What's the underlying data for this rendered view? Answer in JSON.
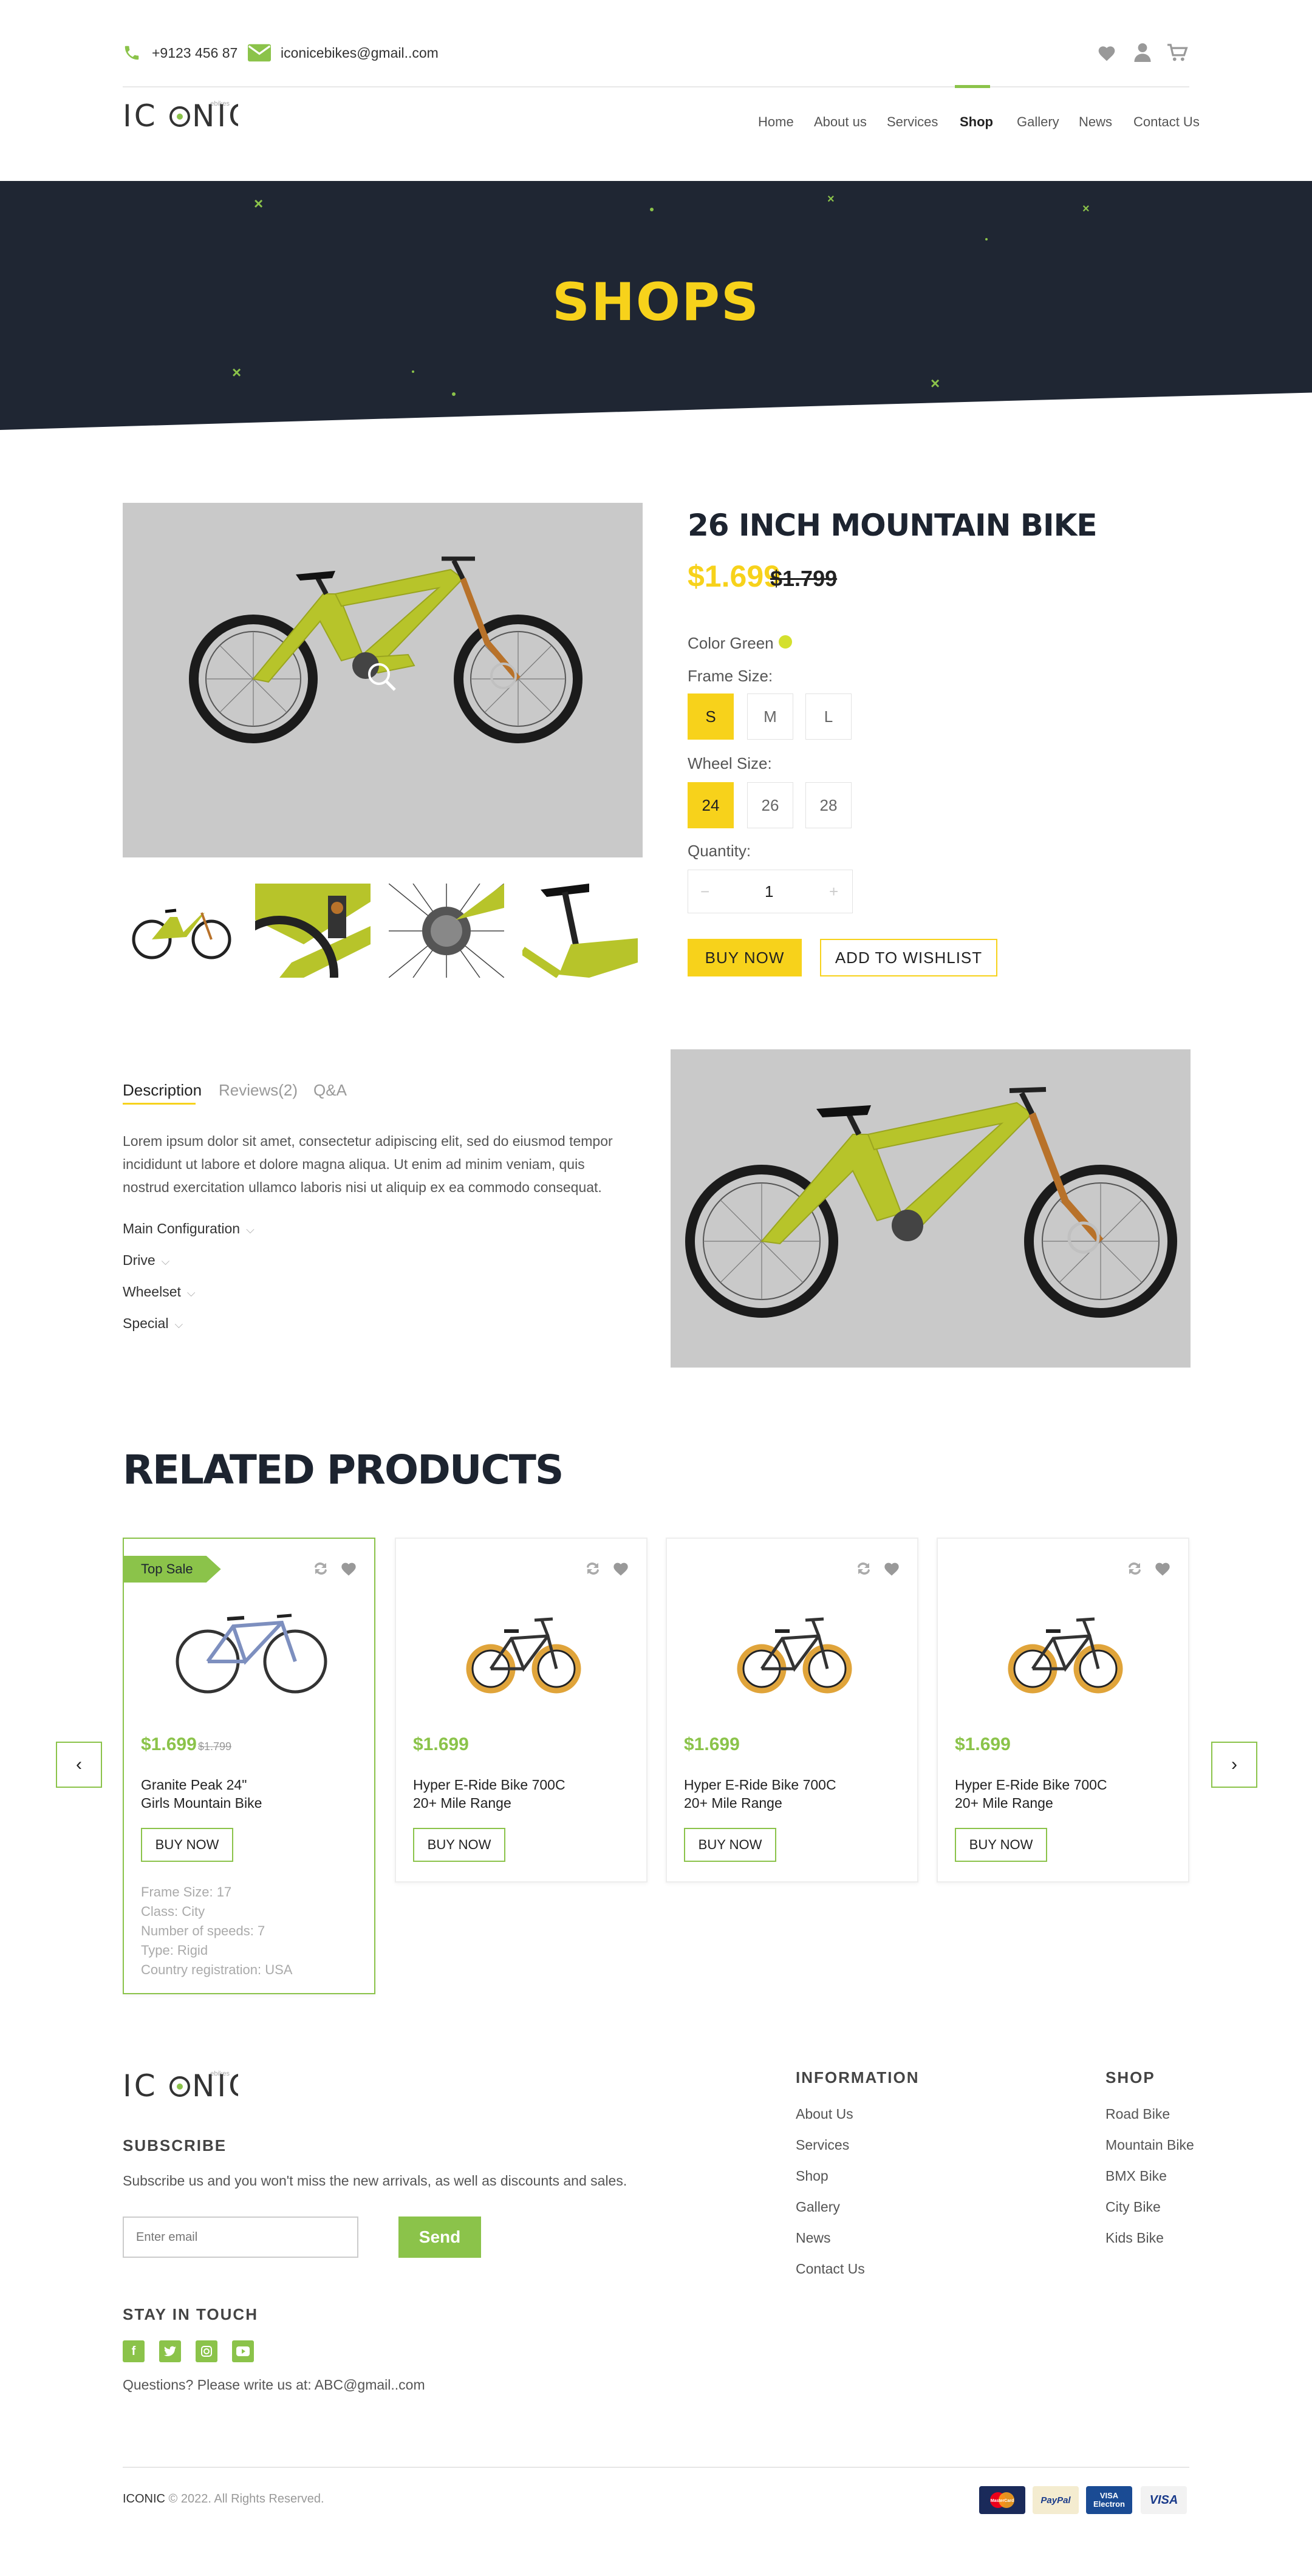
{
  "header": {
    "phone": "+9123 456 87",
    "email": "iconicebikes@gmail..com",
    "logo": "ICONIC",
    "nav": [
      "Home",
      "About us",
      "Services",
      "Shop",
      "Gallery",
      "News",
      "Contact Us"
    ],
    "active_nav": "Shop",
    "icons": [
      "heart-icon",
      "user-icon",
      "cart-icon"
    ]
  },
  "hero": {
    "title": "SHOPS"
  },
  "product": {
    "title": "26 INCH MOUNTAIN BIKE",
    "price": "$1.699",
    "old_price": "$1.799",
    "color_label": "Color Green",
    "frame_label": "Frame Size:",
    "frame_sizes": [
      "S",
      "M",
      "L"
    ],
    "wheel_label": "Wheel Size:",
    "wheel_sizes": [
      "24",
      "26",
      "28"
    ],
    "quantity_label": "Quantity:",
    "quantity": "1",
    "qty_minus": "−",
    "qty_plus": "+",
    "buy_label": "BUY NOW",
    "wishlist_label": "ADD TO WISHLIST"
  },
  "details": {
    "tabs": [
      "Description",
      "Reviews(2)",
      "Q&A"
    ],
    "description": "Lorem ipsum dolor sit amet, consectetur adipiscing elit, sed do eiusmod tempor incididunt ut labore et dolore magna aliqua. Ut enim ad minim veniam, quis nostrud exercitation ullamco laboris nisi ut aliquip ex ea commodo consequat.",
    "accordion": [
      "Main Configuration",
      "Drive",
      "Wheelset",
      "Special"
    ]
  },
  "related": {
    "title": "RELATED PRODUCTS",
    "cards": [
      {
        "badge": "Top Sale",
        "price": "$1.699",
        "old_price": "$1.799",
        "name_line1": "Granite Peak 24\"",
        "name_line2": "Girls Mountain Bike",
        "button": "BUY NOW",
        "specs": [
          "Frame Size: 17",
          "Class: City",
          "Number of speeds: 7",
          "Type: Rigid",
          "Country registration: USA"
        ]
      },
      {
        "price": "$1.699",
        "name_line1": "Hyper E-Ride Bike 700C",
        "name_line2": "20+ Mile Range",
        "button": "BUY NOW"
      },
      {
        "price": "$1.699",
        "name_line1": "Hyper E-Ride Bike 700C",
        "name_line2": "20+ Mile Range",
        "button": "BUY NOW"
      },
      {
        "price": "$1.699",
        "name_line1": "Hyper E-Ride Bike 700C",
        "name_line2": "20+ Mile Range",
        "button": "BUY NOW"
      }
    ]
  },
  "footer": {
    "logo": "ICONIC",
    "subscribe_title": "SUBSCRIBE",
    "subscribe_text": "Subscribe us and you won't miss the new arrivals, as well as discounts and sales.",
    "email_placeholder": "Enter email",
    "send_label": "Send",
    "touch_title": "STAY IN TOUCH",
    "questions": "Questions? Please write us at: ABC@gmail..com",
    "info_title": "INFORMATION",
    "info_links": [
      "About Us",
      "Services",
      "Shop",
      "Gallery",
      "News",
      "Contact Us"
    ],
    "shop_title": "SHOP",
    "shop_links": [
      "Road Bike",
      "Mountain Bike",
      "BMX Bike",
      "City Bike",
      "Kids Bike"
    ],
    "copyright_brand": "ICONIC",
    "copyright": " © 2022. All Rights Reserved.",
    "payments": [
      "MasterCard",
      "PayPal",
      "VISA Electron",
      "VISA"
    ]
  },
  "colors": {
    "accent_green": "#8bc34a",
    "accent_yellow": "#f7d21b",
    "dark": "#1f2633"
  }
}
